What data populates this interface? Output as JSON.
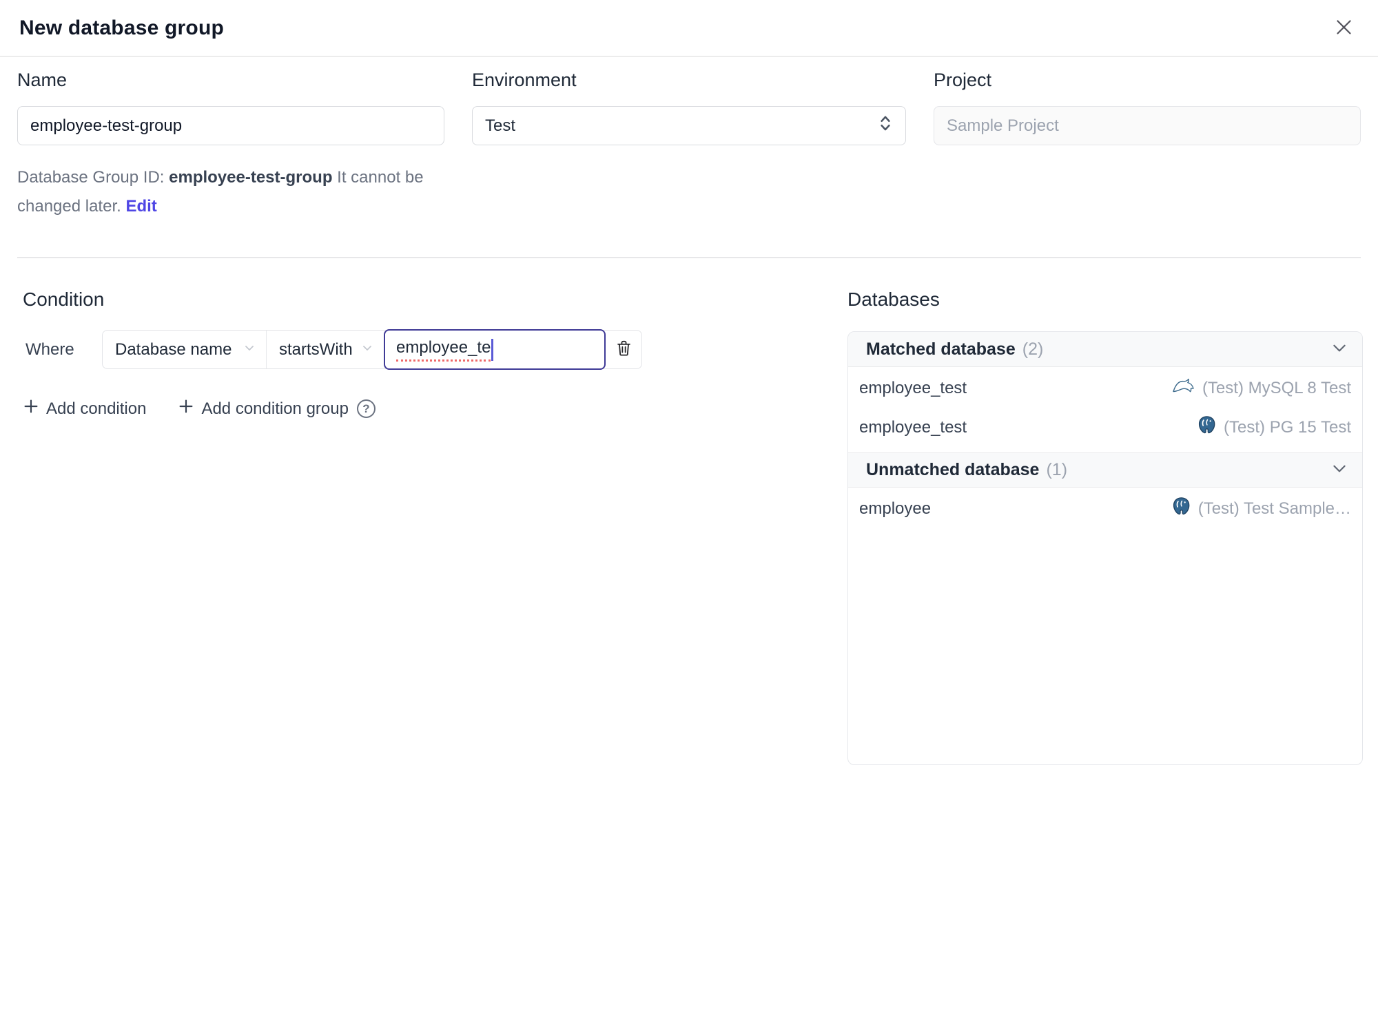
{
  "dialog": {
    "title": "New database group"
  },
  "form": {
    "name": {
      "label": "Name",
      "value": "employee-test-group"
    },
    "environment": {
      "label": "Environment",
      "value": "Test"
    },
    "project": {
      "label": "Project",
      "value": "Sample Project",
      "disabled": true
    },
    "id_helper": {
      "prefix": "Database Group ID: ",
      "id": "employee-test-group",
      "suffix": " It cannot be changed later. ",
      "edit_link": "Edit"
    }
  },
  "condition": {
    "heading": "Condition",
    "where_label": "Where",
    "field_selector": "Database name",
    "operator_selector": "startsWith",
    "value_input": "employee_te",
    "add_condition_label": "Add condition",
    "add_condition_group_label": "Add condition group",
    "help_icon": "?"
  },
  "databases": {
    "heading": "Databases",
    "sections": [
      {
        "title": "Matched database",
        "count": "(2)",
        "rows": [
          {
            "name": "employee_test",
            "engine": "mysql",
            "instance": "(Test) MySQL 8 Test"
          },
          {
            "name": "employee_test",
            "engine": "postgres",
            "instance": "(Test) PG 15 Test"
          }
        ]
      },
      {
        "title": "Unmatched database",
        "count": "(1)",
        "rows": [
          {
            "name": "employee",
            "engine": "postgres",
            "instance": "(Test) Test Sample…"
          }
        ]
      }
    ]
  },
  "icons": {
    "close": "x-icon",
    "select_chevron": "chevron-down-icon",
    "environment_selector": "chevrons-up-down-icon",
    "delete_condition": "trash-icon",
    "add": "plus-icon",
    "help": "question-circle-icon",
    "section_collapse": "chevron-down-icon",
    "mysql": "mysql-dolphin-icon",
    "postgres": "postgresql-elephant-icon"
  },
  "colors": {
    "accent": "#4f46e5",
    "focus_border": "#3f3a96",
    "spellcheck_underline": "#ef6a6a",
    "muted_text": "#9ca3af",
    "panel_border": "#e5e7eb",
    "section_header_bg": "#f8f9fa",
    "mysql_brand": "#31658c",
    "postgres_brand": "#336791"
  }
}
